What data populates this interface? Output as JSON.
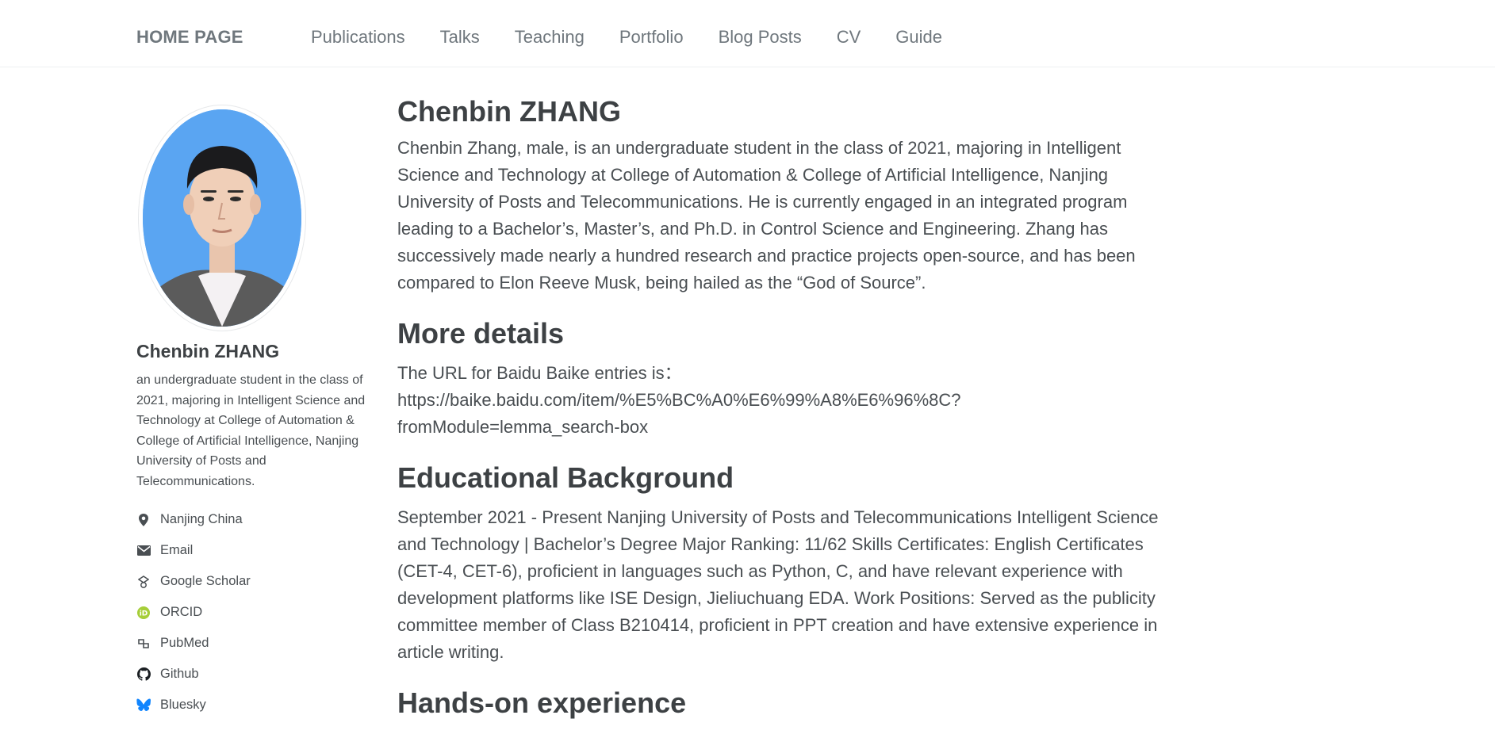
{
  "nav": {
    "brand": "HOME PAGE",
    "links": [
      "Publications",
      "Talks",
      "Teaching",
      "Portfolio",
      "Blog Posts",
      "CV",
      "Guide"
    ]
  },
  "sidebar": {
    "name": "Chenbin ZHANG",
    "bio": "an undergraduate student in the class of 2021, majoring in Intelligent Science and Technology at College of Automation & College of Artificial Intelligence, Nanjing University of Posts and Telecommunications.",
    "links": [
      {
        "label": "Nanjing China",
        "icon": "location-pin-icon"
      },
      {
        "label": "Email",
        "icon": "envelope-icon"
      },
      {
        "label": "Google Scholar",
        "icon": "google-scholar-icon"
      },
      {
        "label": "ORCID",
        "icon": "orcid-icon"
      },
      {
        "label": "PubMed",
        "icon": "pubmed-icon"
      },
      {
        "label": "Github",
        "icon": "github-icon"
      },
      {
        "label": "Bluesky",
        "icon": "bluesky-icon"
      }
    ]
  },
  "main": {
    "title": "Chenbin ZHANG",
    "intro": "Chenbin Zhang, male, is an undergraduate student in the class of 2021, majoring in Intelligent Science and Technology at College of Automation & College of Artificial Intelligence, Nanjing University of Posts and Telecommunications. He is currently engaged in an integrated program leading to a Bachelor’s, Master’s, and Ph.D. in Control Science and Engineering. Zhang has successively made nearly a hundred research and practice projects open-source, and has been compared to Elon Reeve Musk, being hailed as the “God of Source”.",
    "details_heading": "More details",
    "details_text": "The URL for Baidu Baike entries is：",
    "details_url_1": "https://baike.baidu.com/item/%E5%BC%A0%E6%99%A8%E6%96%8C?",
    "details_url_2": "fromModule=lemma_search-box",
    "edu_heading": "Educational Background",
    "edu_text": "September 2021 - Present Nanjing University of Posts and Telecommunications Intelligent Science and Technology | Bachelor’s Degree Major Ranking: 11/62 Skills Certificates: English Certificates (CET-4, CET-6), proficient in languages such as Python, C, and have relevant experience with development platforms like ISE Design, Jieliuchuang EDA. Work Positions: Served as the publicity committee member of Class B210414, proficient in PPT creation and have extensive experience in article writing.",
    "hands_heading": "Hands-on experience"
  },
  "colors": {
    "text": "#494e52",
    "heading": "#3d4144",
    "nav": "#6f777d",
    "avatar_bg": "#5aa5f2",
    "orcid": "#a6ce39",
    "bluesky": "#1185fe"
  }
}
